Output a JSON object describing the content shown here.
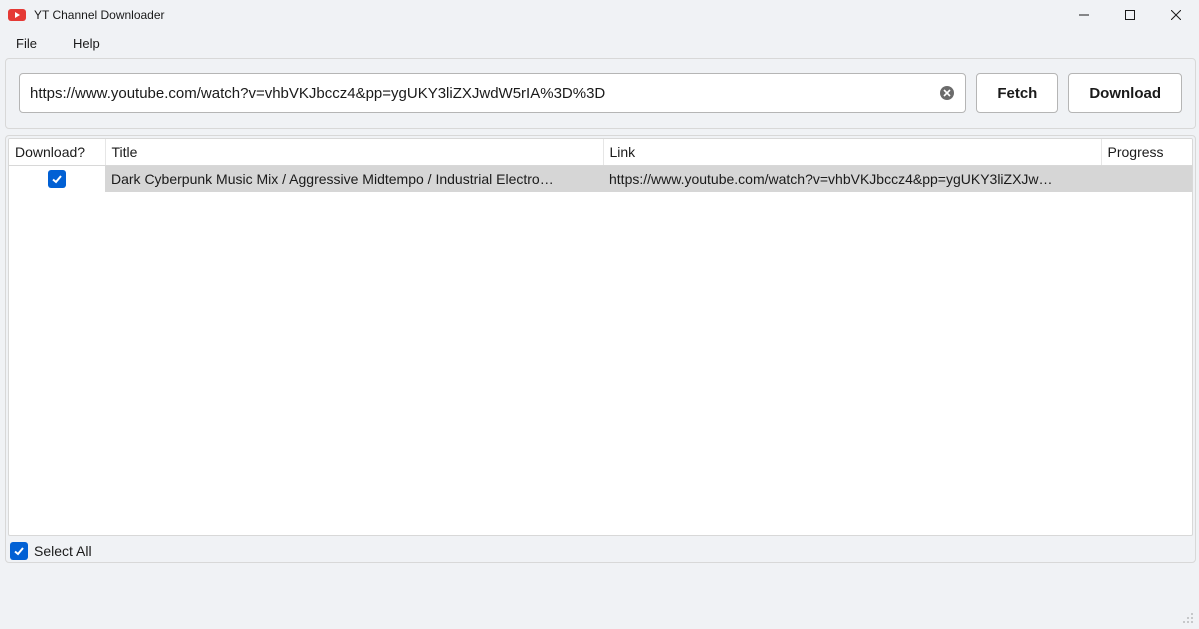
{
  "window": {
    "title": "YT Channel Downloader"
  },
  "menu": {
    "file": "File",
    "help": "Help"
  },
  "url": {
    "value": "https://www.youtube.com/watch?v=vhbVKJbccz4&pp=ygUKY3liZXJwdW5rIA%3D%3D"
  },
  "buttons": {
    "fetch": "Fetch",
    "download": "Download"
  },
  "table": {
    "headers": {
      "download": "Download?",
      "title": "Title",
      "link": "Link",
      "progress": "Progress"
    },
    "rows": [
      {
        "checked": true,
        "title": "Dark Cyberpunk Music Mix / Aggressive Midtempo / Industrial Electro…",
        "link": "https://www.youtube.com/watch?v=vhbVKJbccz4&pp=ygUKY3liZXJw…",
        "progress": ""
      }
    ]
  },
  "selectall": {
    "label": "Select All",
    "checked": true
  }
}
